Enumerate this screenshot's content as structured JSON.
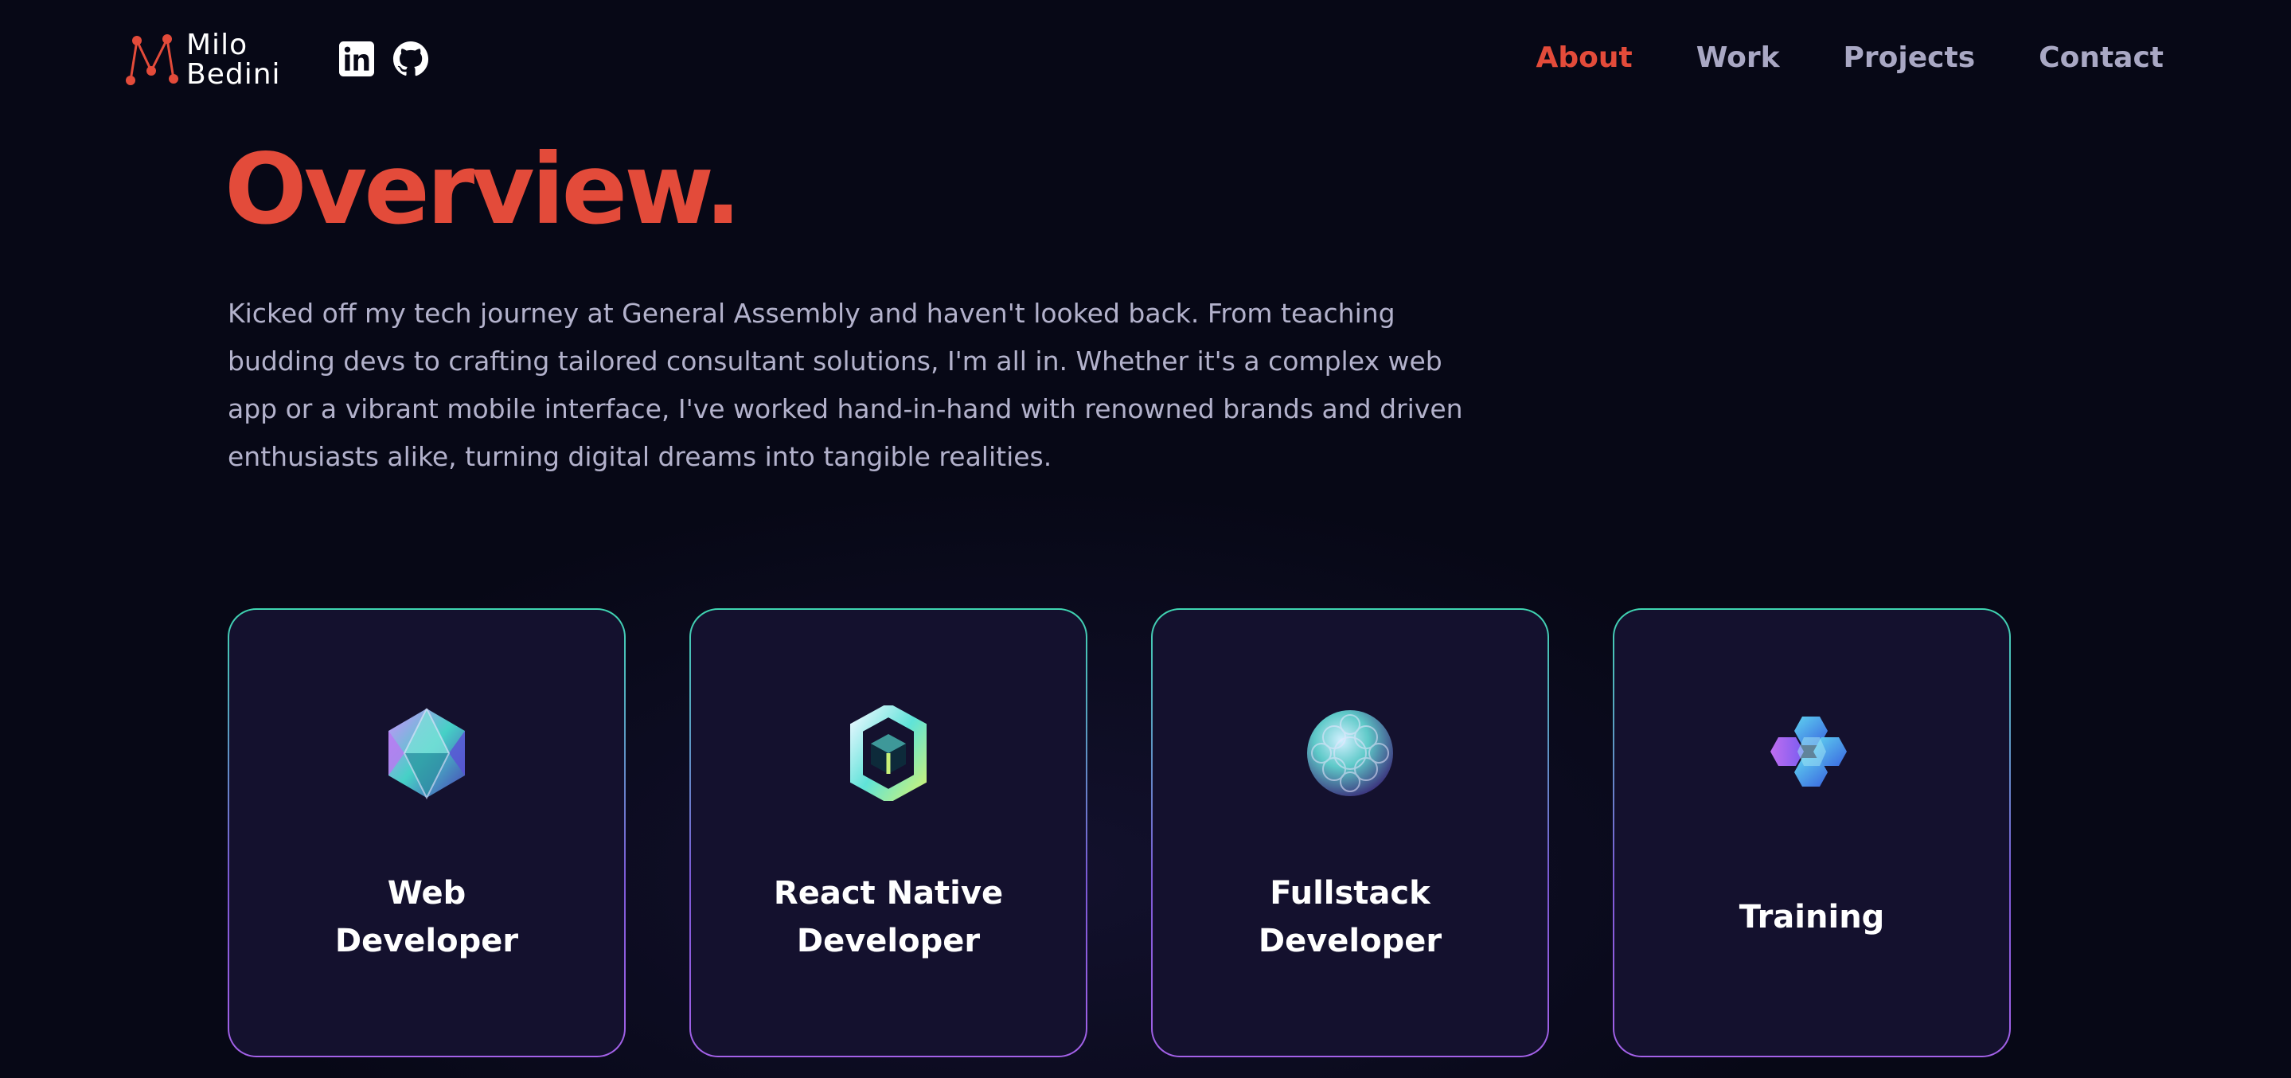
{
  "brand": {
    "name_line1": "Milo",
    "name_line2": "Bedini",
    "accent": "#e34b3a"
  },
  "socials": [
    {
      "icon": "linkedin-icon"
    },
    {
      "icon": "github-icon"
    }
  ],
  "nav": {
    "items": [
      {
        "label": "About",
        "active": true
      },
      {
        "label": "Work",
        "active": false
      },
      {
        "label": "Projects",
        "active": false
      },
      {
        "label": "Contact",
        "active": false
      }
    ]
  },
  "overview": {
    "heading": "Overview.",
    "intro": "Kicked off my tech journey at General Assembly and haven't looked back. From teaching budding devs to crafting tailored consultant solutions, I'm all in. Whether it's a complex web app or a vibrant mobile interface, I've worked hand-in-hand with renowned brands and driven enthusiasts alike, turning digital dreams into tangible realities."
  },
  "services": [
    {
      "title": "Web\nDeveloper",
      "icon": "icosahedron-icon"
    },
    {
      "title": "React Native\nDeveloper",
      "icon": "cube-frame-icon"
    },
    {
      "title": "Fullstack\nDeveloper",
      "icon": "sphere-icon"
    },
    {
      "title": "Training",
      "icon": "hexagon-cluster-icon"
    }
  ],
  "colors": {
    "background": "#070816",
    "card_background": "#14112e",
    "card_border_top": "#3fd6b2",
    "card_border_bottom": "#a461e8",
    "nav_text": "#a9a8c4",
    "body_text": "#b3b2cc"
  }
}
